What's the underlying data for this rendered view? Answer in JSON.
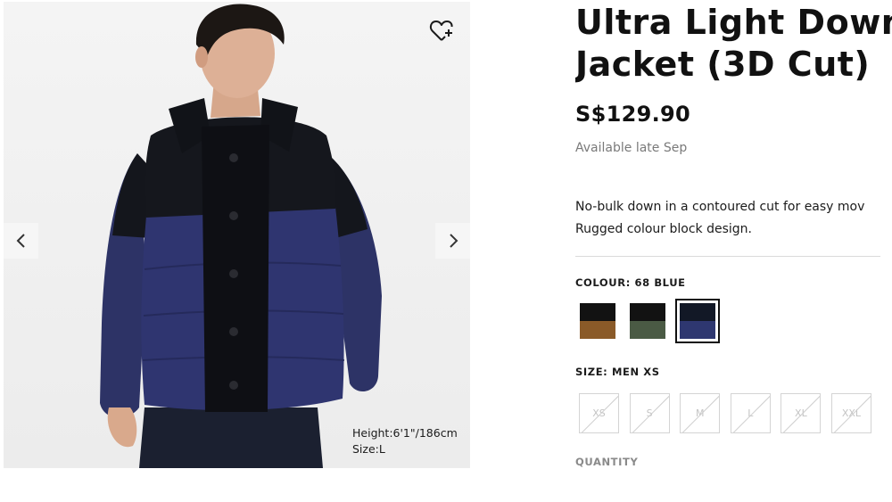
{
  "gallery": {
    "prev_icon": "chevron-left-icon",
    "next_icon": "chevron-right-icon",
    "wishlist_icon": "heart-plus-icon",
    "model_height": "Height:6'1\"/186cm",
    "model_size": "Size:L"
  },
  "product": {
    "title_line1": "Ultra Light Down",
    "title_line2": "Jacket (3D Cut)",
    "price": "S$129.90",
    "availability": "Available late Sep",
    "description_line1": "No-bulk down in a contoured cut for easy mov",
    "description_line2": "Rugged colour block design."
  },
  "colour": {
    "label": "COLOUR: 68 BLUE",
    "swatches": [
      {
        "top": "#141414",
        "bottom": "#8a5a28"
      },
      {
        "top": "#141414",
        "bottom": "#4a5a44"
      },
      {
        "top": "#121826",
        "bottom": "#2e3770",
        "selected": true
      }
    ]
  },
  "size": {
    "label": "SIZE: MEN XS",
    "options": [
      "XS",
      "S",
      "M",
      "L",
      "XL",
      "XXL"
    ],
    "all_unavailable": true
  },
  "quantity": {
    "label": "QUANTITY"
  }
}
